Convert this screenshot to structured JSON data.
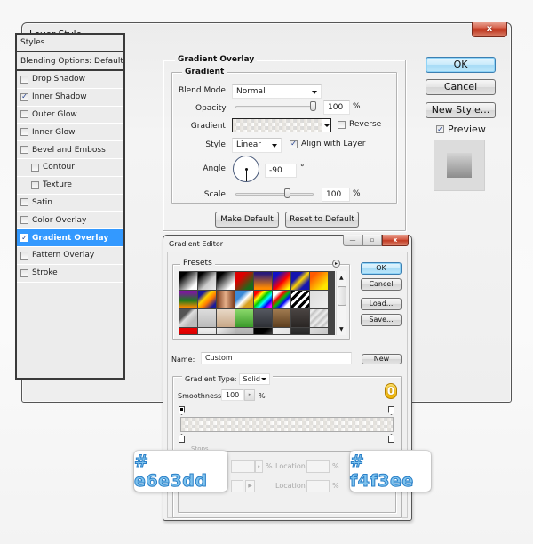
{
  "layer_style": {
    "title": "Layer Style",
    "close_label": "x",
    "styles_header": "Styles",
    "blending_options": "Blending Options: Default",
    "items": [
      {
        "label": "Drop Shadow",
        "checked": false,
        "indent": false,
        "active": false
      },
      {
        "label": "Inner Shadow",
        "checked": true,
        "indent": false,
        "active": false
      },
      {
        "label": "Outer Glow",
        "checked": false,
        "indent": false,
        "active": false
      },
      {
        "label": "Inner Glow",
        "checked": false,
        "indent": false,
        "active": false
      },
      {
        "label": "Bevel and Emboss",
        "checked": false,
        "indent": false,
        "active": false
      },
      {
        "label": "Contour",
        "checked": false,
        "indent": true,
        "active": false
      },
      {
        "label": "Texture",
        "checked": false,
        "indent": true,
        "active": false
      },
      {
        "label": "Satin",
        "checked": false,
        "indent": false,
        "active": false
      },
      {
        "label": "Color Overlay",
        "checked": false,
        "indent": false,
        "active": false
      },
      {
        "label": "Gradient Overlay",
        "checked": true,
        "indent": false,
        "active": true
      },
      {
        "label": "Pattern Overlay",
        "checked": false,
        "indent": false,
        "active": false
      },
      {
        "label": "Stroke",
        "checked": false,
        "indent": false,
        "active": false
      }
    ],
    "section_title": "Gradient Overlay",
    "group_title": "Gradient",
    "blend_mode_label": "Blend Mode:",
    "blend_mode_value": "Normal",
    "opacity_label": "Opacity:",
    "opacity_value": "100",
    "opacity_percent": 100,
    "percent_sign": "%",
    "gradient_label": "Gradient:",
    "reverse_label": "Reverse",
    "reverse_checked": false,
    "style_label": "Style:",
    "style_value": "Linear",
    "align_label": "Align with Layer",
    "align_checked": true,
    "angle_label": "Angle:",
    "angle_value": "-90",
    "degree_sign": "°",
    "scale_label": "Scale:",
    "scale_value": "100",
    "scale_percent": 100,
    "make_default": "Make Default",
    "reset_default": "Reset to Default",
    "ok": "OK",
    "cancel": "Cancel",
    "new_style": "New Style...",
    "preview_label": "Preview",
    "preview_checked": true,
    "check_mark": "✓"
  },
  "gradient_editor": {
    "title": "Gradient Editor",
    "minimize_label": "—",
    "maximize_label": "▫",
    "close_label": "x",
    "presets_label": "Presets",
    "ok": "OK",
    "cancel": "Cancel",
    "load": "Load...",
    "save": "Save...",
    "name_label": "Name:",
    "name_value": "Custom",
    "new_button": "New",
    "gradient_type_label": "Gradient Type:",
    "gradient_type_value": "Solid",
    "smoothness_label": "Smoothness:",
    "smoothness_value": "100",
    "percent_sign": "%",
    "stops_label": "Stops",
    "location_label": "Location:",
    "step_badge": "0",
    "start_color": "#e6e3dd",
    "end_color": "#f4f3ee",
    "presets": [
      "linear-gradient(135deg,#000 20%,#fff 80%)",
      "linear-gradient(135deg,#000 15%,#ccc 60%,#eee 100%)",
      "linear-gradient(135deg,#000 20%,#fff 80%)",
      "linear-gradient(135deg,#d00 30%,#1a6b1a 80%)",
      "linear-gradient(180deg,#2a1a7a 10%,#ff8a00 90%)",
      "linear-gradient(135deg,#1010c8 20%,#ff0000 55%,#ffff00 90%)",
      "linear-gradient(135deg,#1515b0 30%,#ffd400 50%,#1515b0 75%)",
      "linear-gradient(135deg,#ff5a00 20%,#ffe600 80%)",
      "linear-gradient(180deg,#7a1a9a 10%,#1e7a1e 55%,#ff8a00 95%)",
      "linear-gradient(135deg,#1a1a9a 20%,#ffd200 40%,#ff7a00 60%,#1a1a9a 85%)",
      "linear-gradient(90deg,#7a3a1a 0%,#e6b08a 50%,#7a3a1a 100%)",
      "linear-gradient(135deg,#3a8ad8 30%,#fff 50%,#d8a020 70%)",
      "linear-gradient(135deg,#ff0000 15%,#ffff00 30%,#00cc00 45%,#00ffff 60%,#0000ff 75%,#ff00ff 90%)",
      "linear-gradient(135deg,#fff 20%,#ff0000 35%,#00c000 50%,#0000ff 65%,#fff 80%)",
      "repeating-linear-gradient(135deg,#000 0px,#000 3px,#fff 3px,#fff 6px)",
      "linear-gradient(135deg,#ddd 0%,#eee 100%)",
      "linear-gradient(135deg,#555 30%,#ddd 45%,#bbb 70%)",
      "linear-gradient(180deg,#ddd 0%,#bbb 100%)",
      "linear-gradient(180deg,#e8d8c6 0%,#c8a888 100%)",
      "linear-gradient(180deg,#8ad86a 0%,#3a9a2a 100%)",
      "linear-gradient(180deg,#555860 0%,#2e3036 100%)",
      "linear-gradient(180deg,#a07a50 0%,#5e3e1e 100%)",
      "linear-gradient(180deg,#4a4442 0%,#2a2624 100%)",
      "repeating-linear-gradient(135deg,#ccc 0px,#eee 3px,#bbb 6px)",
      "linear-gradient(180deg,#e00 0%,#a00 100%)",
      "linear-gradient(180deg,#eee 0%,#ccc 100%)",
      "linear-gradient(135deg,#eee 0%,#999 100%)",
      "linear-gradient(180deg,#bbb 0%,#999 100%)",
      "linear-gradient(135deg,#000 40%,#888 100%)",
      "linear-gradient(135deg,#eee 0%,#ddd 100%)",
      "linear-gradient(180deg,#333 0%,#111 100%)",
      "linear-gradient(135deg,#ddd 0%,#bbb 100%)"
    ]
  },
  "callouts": {
    "left_hex": "# e6e3dd",
    "right_hex": "# f4f3ee"
  }
}
